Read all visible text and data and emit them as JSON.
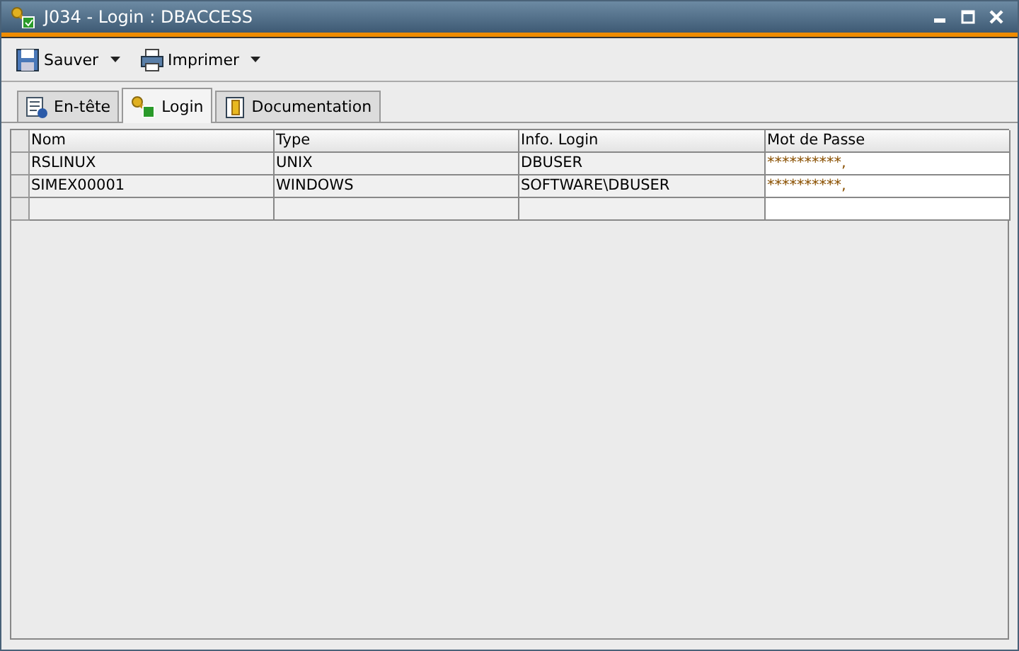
{
  "window": {
    "title": "J034 - Login : DBACCESS"
  },
  "toolbar": [
    {
      "label": "Sauver",
      "kind": "save"
    },
    {
      "label": "Imprimer",
      "kind": "print"
    }
  ],
  "tabs": [
    {
      "label": "En-tête",
      "kind": "info",
      "selected": false
    },
    {
      "label": "Login",
      "kind": "key",
      "selected": true
    },
    {
      "label": "Documentation",
      "kind": "doc",
      "selected": false
    }
  ],
  "table": {
    "columns": [
      "Nom",
      "Type",
      "Info. Login",
      "Mot de Passe"
    ],
    "rows": [
      [
        "RSLINUX",
        "UNIX",
        "DBUSER",
        "**********,"
      ],
      [
        "SIMEX00001",
        "WINDOWS",
        "SOFTWARE\\DBUSER",
        "**********,"
      ]
    ]
  }
}
